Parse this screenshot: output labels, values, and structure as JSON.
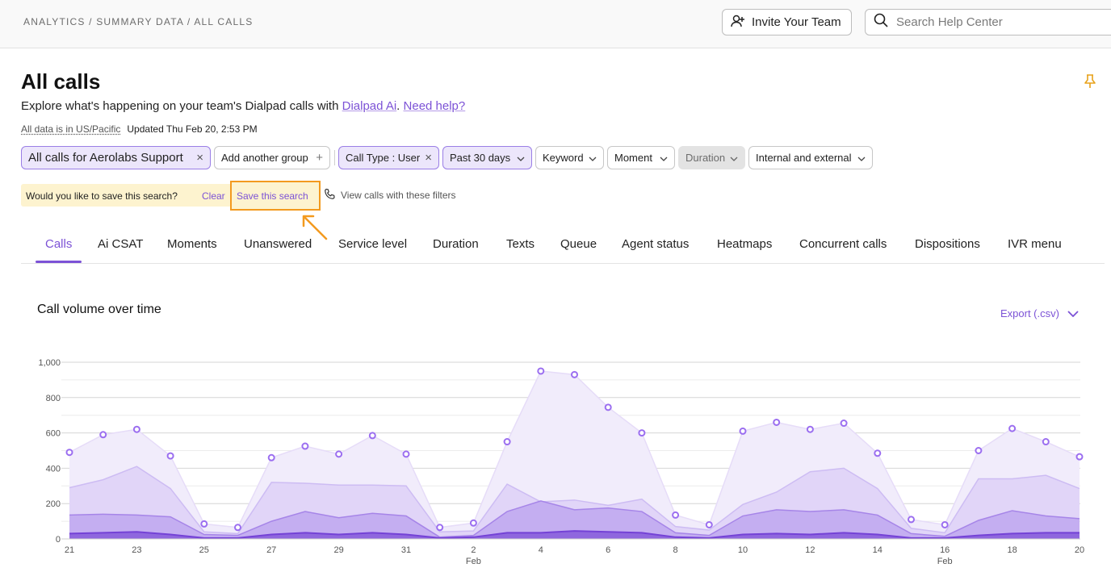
{
  "topbar": {
    "breadcrumb": "ANALYTICS / SUMMARY DATA / ALL CALLS",
    "invite_label": "Invite Your Team",
    "invite_icon": "add-user-icon",
    "search_placeholder": "Search Help Center",
    "search_icon": "search-icon"
  },
  "header": {
    "title": "All calls",
    "subtitle_prefix": "Explore what's happening on your team's Dialpad calls with ",
    "dialpad_ai_link": "Dialpad Ai",
    "subtitle_sep": ". ",
    "need_help_link": "Need help?",
    "timezone": "All data is in US/Pacific",
    "updated": "Updated Thu Feb 20, 2:53 PM",
    "pin_icon": "pin-icon"
  },
  "filters": {
    "group": "All calls for Aerolabs Support",
    "add_group": "Add another group",
    "call_type": "Call Type : User",
    "date_range": "Past 30 days",
    "keyword": "Keyword",
    "moment": "Moment",
    "duration": "Duration",
    "internal_external": "Internal and external"
  },
  "save_search": {
    "question": "Would you like to save this search?",
    "clear": "Clear",
    "save": "Save this search",
    "view_calls": "View calls with these filters"
  },
  "tabs": [
    "Calls",
    "Ai CSAT",
    "Moments",
    "Unanswered",
    "Service level",
    "Duration",
    "Texts",
    "Queue",
    "Agent status",
    "Heatmaps",
    "Concurrent calls",
    "Dispositions",
    "IVR menu"
  ],
  "active_tab": "Calls",
  "chart": {
    "title": "Call volume over time",
    "export": "Export (.csv)"
  },
  "colors": {
    "accent": "#7c52d6",
    "highlight_border": "#f39a1f",
    "save_bar_bg": "#fdf3cf"
  },
  "chart_data": {
    "type": "area",
    "title": "Call volume over time",
    "x": [
      "21",
      "22",
      "23",
      "24",
      "25",
      "26",
      "27",
      "28",
      "29",
      "30",
      "31",
      "1",
      "2",
      "3",
      "4",
      "5",
      "6",
      "7",
      "8",
      "9",
      "10",
      "11",
      "12",
      "13",
      "14",
      "15",
      "16",
      "17",
      "18",
      "19",
      "20"
    ],
    "x_tick_labels": [
      "21",
      "23",
      "25",
      "27",
      "29",
      "31",
      "2",
      "4",
      "6",
      "8",
      "10",
      "12",
      "14",
      "16",
      "18",
      "20"
    ],
    "x_sublabels": {
      "2": "Feb",
      "16": "Feb"
    },
    "ylim": [
      0,
      1000
    ],
    "y_ticks": [
      0,
      200,
      400,
      600,
      800,
      1000
    ],
    "y_tick_labels": [
      "0",
      "200",
      "400",
      "600",
      "800",
      "1,000"
    ],
    "grid": true,
    "series": [
      {
        "values": [
          490,
          590,
          620,
          470,
          85,
          65,
          460,
          525,
          480,
          585,
          480,
          65,
          90,
          550,
          950,
          930,
          745,
          600,
          135,
          80,
          610,
          660,
          620,
          655,
          485,
          110,
          80,
          500,
          625,
          550,
          465
        ],
        "color": "#f1ecfb",
        "markers": true
      },
      {
        "values": [
          290,
          335,
          410,
          285,
          40,
          30,
          320,
          315,
          305,
          305,
          300,
          40,
          45,
          310,
          210,
          220,
          190,
          225,
          70,
          50,
          195,
          265,
          380,
          400,
          285,
          60,
          35,
          340,
          340,
          360,
          285
        ],
        "color": "#e1d5f8"
      },
      {
        "values": [
          135,
          140,
          135,
          125,
          25,
          20,
          100,
          155,
          120,
          145,
          130,
          10,
          20,
          155,
          215,
          165,
          175,
          155,
          35,
          20,
          130,
          165,
          155,
          165,
          135,
          30,
          15,
          105,
          160,
          130,
          115
        ],
        "color": "#c4aef1"
      },
      {
        "values": [
          30,
          35,
          40,
          25,
          5,
          5,
          25,
          35,
          25,
          35,
          25,
          5,
          10,
          35,
          35,
          45,
          40,
          35,
          10,
          5,
          25,
          30,
          25,
          35,
          25,
          5,
          5,
          20,
          30,
          35,
          35
        ],
        "color": "#8f67de"
      }
    ]
  }
}
